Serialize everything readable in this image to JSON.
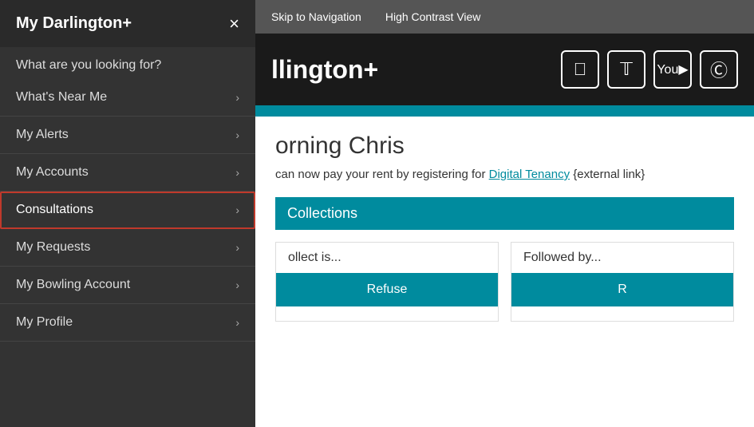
{
  "accessibility": {
    "skip_nav": "Skip to Navigation",
    "high_contrast": "High Contrast View"
  },
  "header": {
    "logo": "llington+",
    "social": [
      {
        "name": "facebook",
        "icon": "f"
      },
      {
        "name": "twitter",
        "icon": "t"
      },
      {
        "name": "youtube",
        "icon": "▶"
      },
      {
        "name": "other",
        "icon": "c"
      }
    ]
  },
  "greeting": {
    "morning": "orning Chris",
    "sub_text": "can now pay your rent by registering for ",
    "link_text": "Digital Tenancy",
    "link_suffix": " {external link}"
  },
  "collections": {
    "section_title": "Collections",
    "card1": {
      "label": "ollect is...",
      "button": "Refuse"
    },
    "card2": {
      "label": "Followed by...",
      "button": "R"
    }
  },
  "sidebar": {
    "title": "My Darlington+",
    "close_label": "×",
    "subtitle": "What are you looking for?",
    "items": [
      {
        "label": "What's Near Me",
        "active": false,
        "highlighted": false
      },
      {
        "label": "My Alerts",
        "active": false,
        "highlighted": false
      },
      {
        "label": "My Accounts",
        "active": false,
        "highlighted": false
      },
      {
        "label": "Consultations",
        "active": false,
        "highlighted": true
      },
      {
        "label": "My Requests",
        "active": false,
        "highlighted": false
      },
      {
        "label": "My Bowling Account",
        "active": false,
        "highlighted": false
      },
      {
        "label": "My Profile",
        "active": false,
        "highlighted": false
      }
    ]
  }
}
